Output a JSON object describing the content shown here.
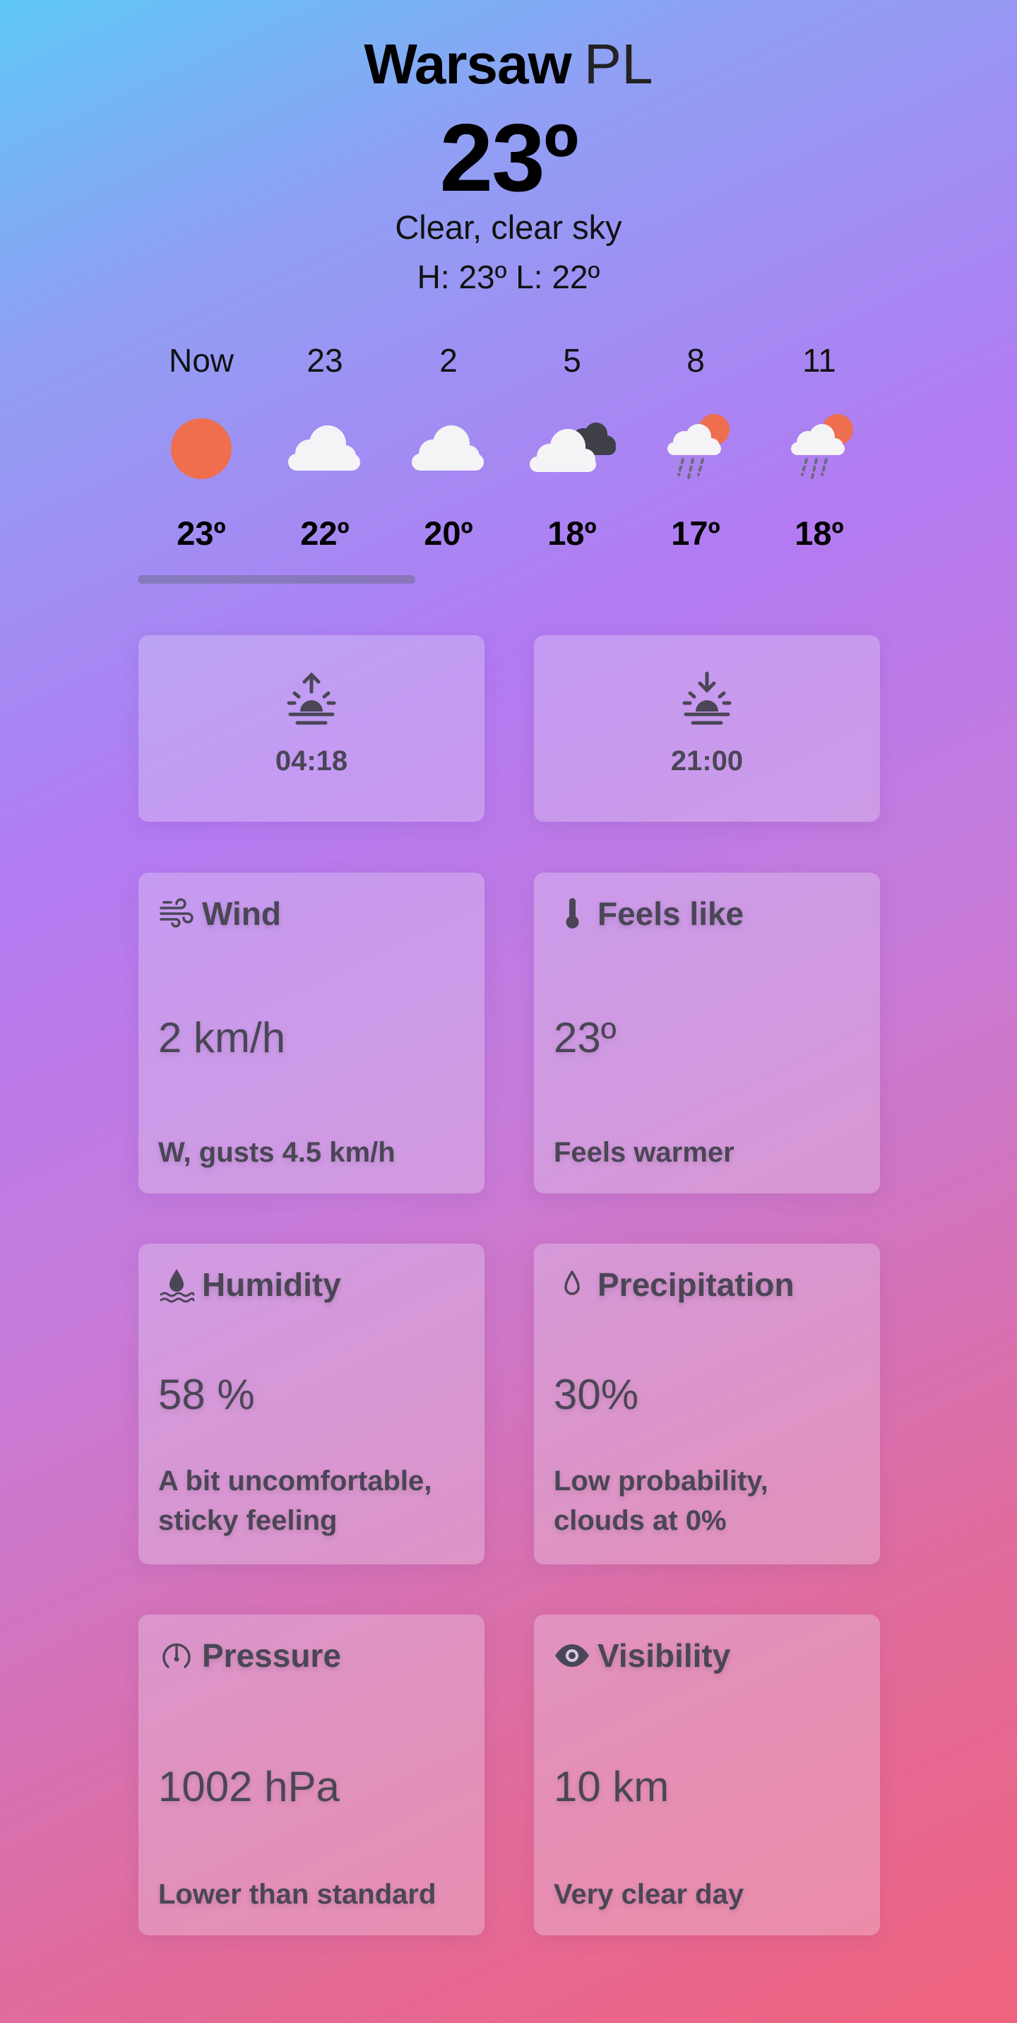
{
  "header": {
    "city": "Warsaw",
    "country": "PL",
    "temperature": "23º",
    "description": "Clear, clear sky",
    "high_low": "H: 23º L: 22º"
  },
  "hourly": [
    {
      "time": "Now",
      "icon": "sun-icon",
      "temp": "23º"
    },
    {
      "time": "23",
      "icon": "cloud-icon",
      "temp": "22º"
    },
    {
      "time": "2",
      "icon": "cloud-icon",
      "temp": "20º"
    },
    {
      "time": "5",
      "icon": "dark-clouds-icon",
      "temp": "18º"
    },
    {
      "time": "8",
      "icon": "sun-rain-cloud-icon",
      "temp": "17º"
    },
    {
      "time": "11",
      "icon": "sun-rain-cloud-icon",
      "temp": "18º"
    }
  ],
  "sun": {
    "sunrise": {
      "time": "04:18",
      "icon": "sunrise-icon"
    },
    "sunset": {
      "time": "21:00",
      "icon": "sunset-icon"
    }
  },
  "metrics": {
    "wind": {
      "title": "Wind",
      "icon": "wind-icon",
      "value": "2 km/h",
      "note": "W, gusts 4.5 km/h"
    },
    "feels_like": {
      "title": "Feels like",
      "icon": "thermometer-icon",
      "value": "23º",
      "note": "Feels warmer"
    },
    "humidity": {
      "title": "Humidity",
      "icon": "humidity-icon",
      "value": "58 %",
      "note": "A bit uncomfortable, sticky feeling"
    },
    "precipitation": {
      "title": "Precipitation",
      "icon": "droplet-icon",
      "value": "30%",
      "note": "Low probability, clouds at 0%"
    },
    "pressure": {
      "title": "Pressure",
      "icon": "gauge-icon",
      "value": "1002 hPa",
      "note": "Lower than standard"
    },
    "visibility": {
      "title": "Visibility",
      "icon": "eye-icon",
      "value": "10 km",
      "note": "Very clear day"
    }
  },
  "colors": {
    "sun": "#ee6e4e",
    "card_text": "#4a4656"
  }
}
